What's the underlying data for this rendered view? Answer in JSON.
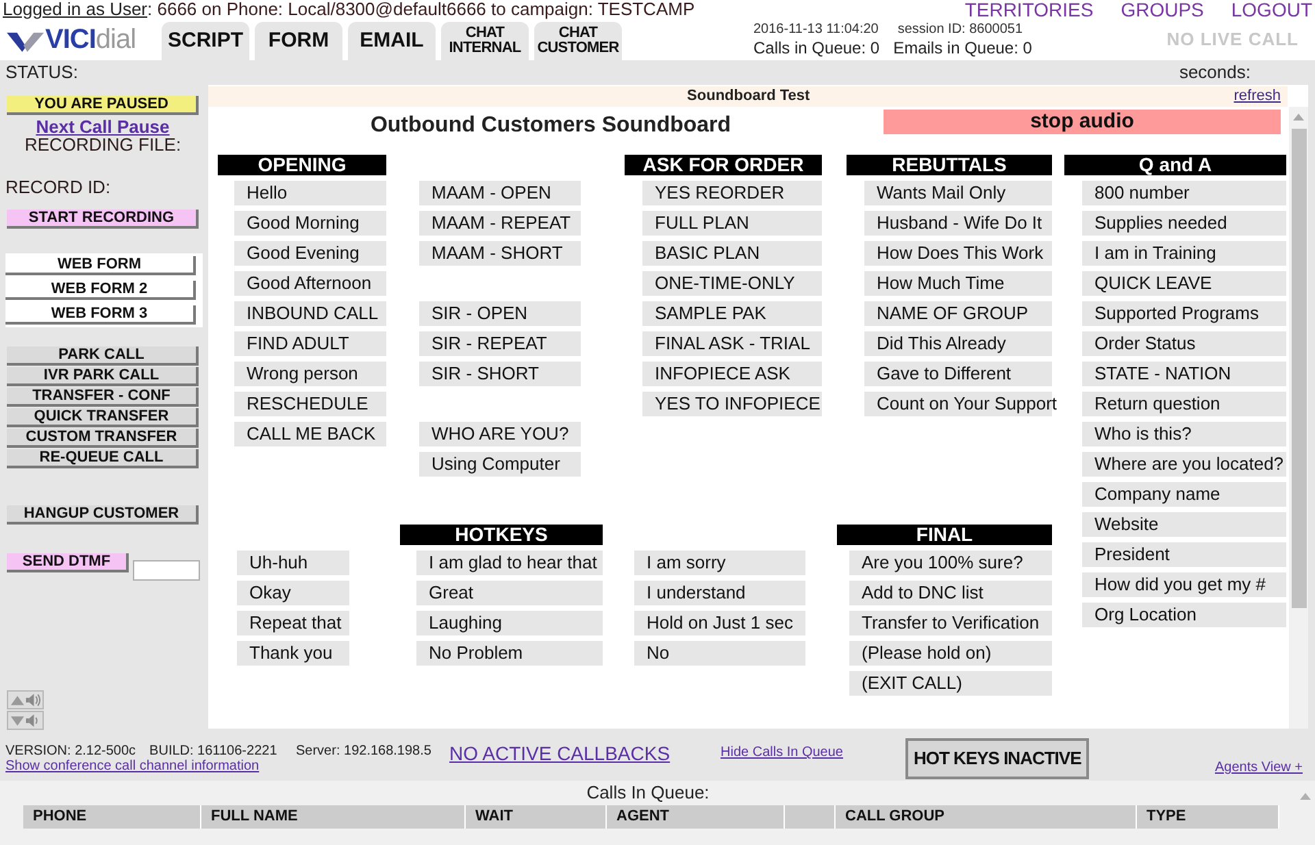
{
  "login": {
    "link": "Logged in as User",
    "text": ": 6666 on Phone: Local/8300@default6666  to campaign: TESTCAMP"
  },
  "nav_links": [
    "TERRITORIES",
    "GROUPS",
    "LOGOUT"
  ],
  "logo": {
    "bold": "VICI",
    "light": "dial"
  },
  "tabs": [
    {
      "label": "SCRIPT",
      "kind": "large"
    },
    {
      "label": "FORM",
      "kind": "large"
    },
    {
      "label": "EMAIL",
      "kind": "large"
    },
    {
      "label": "CHAT INTERNAL",
      "kind": "stacked"
    },
    {
      "label": "CHAT CUSTOMER",
      "kind": "stacked"
    }
  ],
  "clock": {
    "time": "2016-11-13 11:04:20",
    "session": "session ID: 8600051"
  },
  "queue_counts": [
    "Calls in Queue: 0",
    "Emails in Queue: 0"
  ],
  "call_state": "NO LIVE CALL",
  "status": {
    "label": "STATUS:",
    "seconds": "seconds:"
  },
  "sidebar": {
    "pause_button": "YOU ARE PAUSED",
    "pause_link": "Next Call Pause",
    "recording_file": "RECORDING FILE:",
    "record_id": "RECORD ID:",
    "record_button": "START RECORDING",
    "web_forms": [
      "WEB FORM",
      "WEB FORM 2",
      "WEB FORM 3"
    ],
    "call_buttons": [
      "PARK CALL",
      "IVR PARK CALL",
      "TRANSFER - CONF",
      "QUICK TRANSFER",
      "CUSTOM TRANSFER",
      "RE-QUEUE CALL"
    ],
    "hangup_button": "HANGUP CUSTOMER",
    "dtmf_button": "SEND DTMF"
  },
  "soundboard": {
    "frame_title": "Soundboard Test",
    "refresh": "refresh",
    "title": "Outbound Customers Soundboard",
    "stop": "stop audio",
    "sections": [
      {
        "columns": [
          {
            "title": "OPENING",
            "clusters": [
              [
                "Hello",
                "Good Morning",
                "Good Evening",
                "Good Afternoon",
                "INBOUND CALL",
                "FIND ADULT",
                "Wrong person",
                "RESCHEDULE",
                "CALL ME BACK"
              ]
            ]
          },
          {
            "clusters": [
              [
                "MAAM - OPEN",
                "MAAM - REPEAT",
                "MAAM - SHORT"
              ],
              [
                "SIR - OPEN",
                "SIR - REPEAT",
                "SIR - SHORT"
              ],
              [
                "WHO ARE YOU?",
                "Using Computer"
              ]
            ]
          },
          {
            "title": "ASK FOR ORDER",
            "clusters": [
              [
                "YES REORDER",
                "FULL PLAN",
                "BASIC PLAN",
                "ONE-TIME-ONLY",
                "SAMPLE PAK",
                "FINAL ASK - TRIAL",
                "INFOPIECE ASK",
                "YES TO INFOPIECE"
              ]
            ]
          },
          {
            "title": "REBUTTALS",
            "clusters": [
              [
                "Wants Mail Only",
                "Husband - Wife Do It",
                "How Does This Work",
                "How Much Time",
                "NAME OF GROUP",
                "Did This Already",
                "Gave to Different",
                "Count on Your Support"
              ]
            ]
          }
        ]
      },
      {
        "columns": [
          {
            "clusters": [
              [
                "Uh-huh",
                "Okay",
                "Repeat that",
                "Thank you"
              ]
            ]
          },
          {
            "title": "HOTKEYS",
            "clusters": [
              [
                "I am glad to hear that",
                "Great",
                "Laughing",
                "No Problem"
              ]
            ]
          },
          {
            "clusters": [
              [
                "I am sorry",
                "I understand",
                "Hold on Just 1 sec",
                "No"
              ]
            ]
          },
          {
            "title": "FINAL",
            "clusters": [
              [
                "Are you 100% sure?",
                "Add to DNC list",
                "Transfer to Verification",
                "(Please hold on)",
                "(EXIT CALL)"
              ]
            ]
          }
        ]
      }
    ],
    "qa": {
      "title": "Q and A",
      "buttons": [
        "800 number",
        "Supplies needed",
        "I am in Training",
        "QUICK LEAVE",
        "Supported Programs",
        "Order Status",
        "STATE - NATION",
        "Return question",
        "Who is this?",
        "Where are you located?",
        "Company name",
        "Website",
        "President",
        "How did you get my #",
        "Org Location"
      ]
    }
  },
  "footer": {
    "version": "VERSION: 2.12-500c",
    "build": "BUILD: 161106-2221",
    "conf_link": "Show conference call channel information",
    "server": "Server: 192.168.198.5",
    "callbacks": "NO ACTIVE CALLBACKS",
    "hide_queue": "Hide Calls In Queue",
    "hotkeys": "HOT KEYS INACTIVE",
    "agents_view": "Agents View +"
  },
  "queue": {
    "title": "Calls In Queue:",
    "columns": [
      {
        "kind": "label",
        "label": "PHONE"
      },
      {
        "kind": "label",
        "label": "FULL NAME"
      },
      {
        "kind": "label",
        "label": "WAIT"
      },
      {
        "kind": "label",
        "label": "AGENT"
      },
      {
        "kind": "blank"
      },
      {
        "kind": "label",
        "label": "CALL GROUP"
      },
      {
        "kind": "label",
        "label": "TYPE"
      }
    ]
  }
}
